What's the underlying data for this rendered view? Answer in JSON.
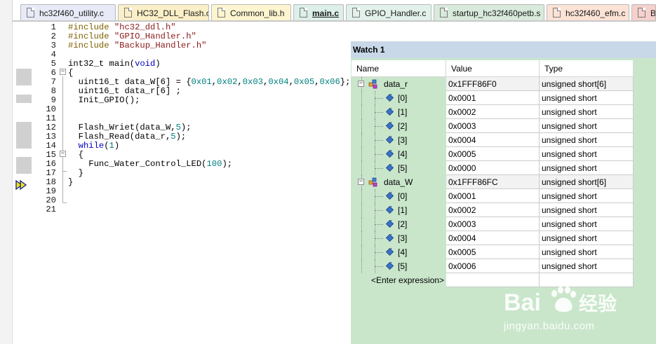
{
  "tabs": [
    {
      "label": "hc32f460_utility.c",
      "color": "#e8ebf7",
      "active": false
    },
    {
      "label": "HC32_DLL_Flash.c",
      "color": "#fbefc8",
      "active": false
    },
    {
      "label": "Common_lib.h",
      "color": "#fcf5cf",
      "active": false
    },
    {
      "label": "main.c",
      "color": "#dcefe8",
      "active": true
    },
    {
      "label": "GPIO_Handler.c",
      "color": "#e2f1ea",
      "active": false
    },
    {
      "label": "startup_hc32f460petb.s",
      "color": "#d8eadb",
      "active": false
    },
    {
      "label": "hc32f460_efm.c",
      "color": "#fbe3d6",
      "active": false
    },
    {
      "label": "Ba",
      "color": "#f6d0cc",
      "active": false
    }
  ],
  "editor": {
    "line_numbers": [
      "1",
      "2",
      "3",
      "4",
      "5",
      "6",
      "7",
      "8",
      "9",
      "10",
      "11",
      "12",
      "13",
      "14",
      "15",
      "16",
      "17",
      "18",
      "19",
      "20",
      "21"
    ],
    "lines": [
      [
        {
          "t": "#include ",
          "c": "pp"
        },
        {
          "t": "\"hc32_ddl.h\"",
          "c": "str"
        }
      ],
      [
        {
          "t": "#include ",
          "c": "pp"
        },
        {
          "t": "\"GPIO_Handler.h\"",
          "c": "str"
        }
      ],
      [
        {
          "t": "#include ",
          "c": "pp"
        },
        {
          "t": "\"Backup_Handler.h\"",
          "c": "str"
        }
      ],
      [],
      [
        {
          "t": "int32_t main(",
          "c": ""
        },
        {
          "t": "void",
          "c": "kw"
        },
        {
          "t": ")",
          "c": ""
        }
      ],
      [
        {
          "t": "{",
          "c": ""
        }
      ],
      [
        {
          "t": "  uint16_t data_W[6] = {",
          "c": ""
        },
        {
          "t": "0x01",
          "c": "num"
        },
        {
          "t": ",",
          "c": ""
        },
        {
          "t": "0x02",
          "c": "num"
        },
        {
          "t": ",",
          "c": ""
        },
        {
          "t": "0x03",
          "c": "num"
        },
        {
          "t": ",",
          "c": ""
        },
        {
          "t": "0x04",
          "c": "num"
        },
        {
          "t": ",",
          "c": ""
        },
        {
          "t": "0x05",
          "c": "num"
        },
        {
          "t": ",",
          "c": ""
        },
        {
          "t": "0x06",
          "c": "num"
        },
        {
          "t": "};",
          "c": ""
        }
      ],
      [
        {
          "t": "  uint16_t data_r[6] ;",
          "c": ""
        }
      ],
      [
        {
          "t": "  Init_GPIO();",
          "c": ""
        }
      ],
      [],
      [],
      [
        {
          "t": "  Flash_Wriet(data_W,",
          "c": ""
        },
        {
          "t": "5",
          "c": "num"
        },
        {
          "t": ");",
          "c": ""
        }
      ],
      [
        {
          "t": "  Flash_Read(data_r,",
          "c": ""
        },
        {
          "t": "5",
          "c": "num"
        },
        {
          "t": ");",
          "c": ""
        }
      ],
      [
        {
          "t": "  ",
          "c": ""
        },
        {
          "t": "while",
          "c": "kw"
        },
        {
          "t": "(",
          "c": ""
        },
        {
          "t": "1",
          "c": "num"
        },
        {
          "t": ")",
          "c": ""
        }
      ],
      [
        {
          "t": "  {",
          "c": ""
        }
      ],
      [
        {
          "t": "    Func_Water_Control_LED(",
          "c": ""
        },
        {
          "t": "100",
          "c": "num"
        },
        {
          "t": ");",
          "c": ""
        }
      ],
      [
        {
          "t": "  }",
          "c": ""
        }
      ],
      [
        {
          "t": "}",
          "c": ""
        }
      ],
      [],
      [],
      []
    ]
  },
  "watch": {
    "title": "Watch 1",
    "columns": {
      "name": "Name",
      "value": "Value",
      "type": "Type"
    },
    "rows": [
      {
        "kind": "parent",
        "name": "data_r",
        "value": "0x1FFF86F0",
        "type": "unsigned short[6]",
        "expander": "−"
      },
      {
        "kind": "child",
        "name": "[0]",
        "value": "0x0001",
        "type": "unsigned short"
      },
      {
        "kind": "child",
        "name": "[1]",
        "value": "0x0002",
        "type": "unsigned short"
      },
      {
        "kind": "child",
        "name": "[2]",
        "value": "0x0003",
        "type": "unsigned short"
      },
      {
        "kind": "child",
        "name": "[3]",
        "value": "0x0004",
        "type": "unsigned short"
      },
      {
        "kind": "child",
        "name": "[4]",
        "value": "0x0005",
        "type": "unsigned short"
      },
      {
        "kind": "child",
        "name": "[5]",
        "value": "0x0000",
        "type": "unsigned short"
      },
      {
        "kind": "parent",
        "name": "data_W",
        "value": "0x1FFF86FC",
        "type": "unsigned short[6]",
        "expander": "−"
      },
      {
        "kind": "child",
        "name": "[0]",
        "value": "0x0001",
        "type": "unsigned short"
      },
      {
        "kind": "child",
        "name": "[1]",
        "value": "0x0002",
        "type": "unsigned short"
      },
      {
        "kind": "child",
        "name": "[2]",
        "value": "0x0003",
        "type": "unsigned short"
      },
      {
        "kind": "child",
        "name": "[3]",
        "value": "0x0004",
        "type": "unsigned short"
      },
      {
        "kind": "child",
        "name": "[4]",
        "value": "0x0005",
        "type": "unsigned short"
      },
      {
        "kind": "child",
        "name": "[5]",
        "value": "0x0006",
        "type": "unsigned short"
      },
      {
        "kind": "enter",
        "name": "<Enter expression>",
        "value": "",
        "type": ""
      }
    ]
  },
  "watermark": {
    "brand": "Bai",
    "brand2": "经验",
    "url": "jingyan.baidu.com"
  },
  "colors": {
    "keyword": "#0000c0",
    "preprocessor": "#806000",
    "string": "#8b1a1a",
    "number": "#008080",
    "watch_bg": "#c9e6cb",
    "watch_title_bg": "#c8d8e8"
  }
}
